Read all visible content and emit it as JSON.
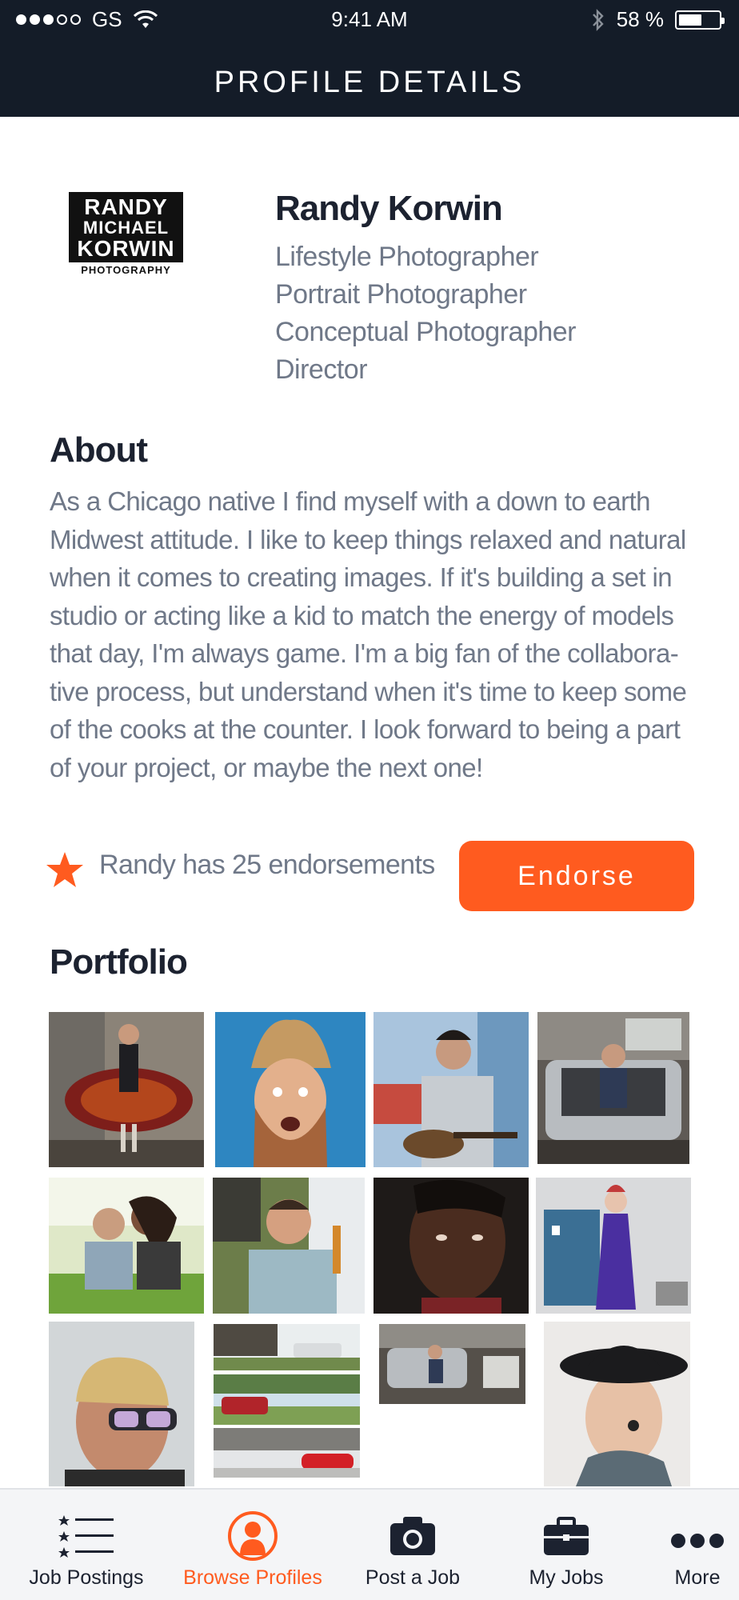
{
  "status_bar": {
    "carrier": "GS",
    "time": "9:41 AM",
    "battery": "58 %",
    "battery_level": 0.58
  },
  "header": {
    "title": "PROFILE DETAILS"
  },
  "profile": {
    "logo_lines": [
      "RANDY",
      "MICHAEL",
      "KORWIN"
    ],
    "logo_sub": "PHOTOGRAPHY",
    "name": "Randy Korwin",
    "roles": [
      "Lifestyle Photographer",
      "Portrait Photographer",
      "Conceptual Photographer",
      "Director"
    ]
  },
  "about": {
    "heading": "About",
    "lines": [
      "As a Chicago native I find myself with a down to earth",
      "Midwest attitude. I like to keep things relaxed and natural",
      "when it comes to creating images. If it's building a set in",
      "studio or acting like a kid to match the energy of models",
      "that day, I'm always game. I'm a big fan of the collabora-",
      "tive process, but understand when it's time to keep some",
      "of the cooks at the counter. I look forward to being a part",
      "of your project, or maybe the next one!"
    ]
  },
  "endorsements": {
    "text": "Randy has 25 endorsements",
    "button_label": "Endorse"
  },
  "portfolio": {
    "heading": "Portfolio"
  },
  "tabs": [
    {
      "label": "Job Postings",
      "icon": "job-postings-icon"
    },
    {
      "label": "Browse Profiles",
      "icon": "browse-profiles-icon",
      "active": true
    },
    {
      "label": "Post a Job",
      "icon": "camera-icon"
    },
    {
      "label": "My Jobs",
      "icon": "briefcase-icon"
    },
    {
      "label": "More",
      "icon": "more-icon"
    }
  ],
  "colors": {
    "accent": "#ff5b1f",
    "navy": "#141c28",
    "text_gray": "#6f7888"
  }
}
